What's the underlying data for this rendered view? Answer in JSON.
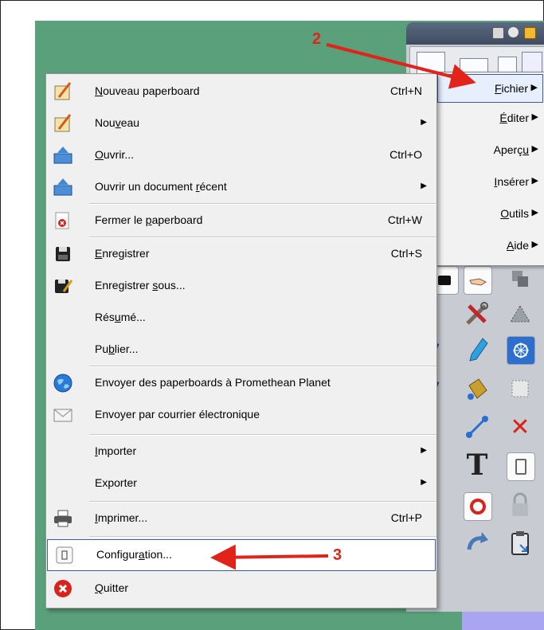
{
  "menu": {
    "items": [
      {
        "pre": "",
        "acc": "N",
        "post": "ouveau paperboard",
        "shortcut": "Ctrl+N",
        "submenu": false
      },
      {
        "pre": "Nou",
        "acc": "v",
        "post": "eau",
        "shortcut": "",
        "submenu": true
      },
      {
        "pre": "",
        "acc": "O",
        "post": "uvrir...",
        "shortcut": "Ctrl+O",
        "submenu": false
      },
      {
        "pre": "Ouvrir un document ",
        "acc": "r",
        "post": "écent",
        "shortcut": "",
        "submenu": true
      },
      {
        "pre": "Fermer le ",
        "acc": "p",
        "post": "aperboard",
        "shortcut": "Ctrl+W",
        "submenu": false
      },
      {
        "pre": "",
        "acc": "E",
        "post": "nregistrer",
        "shortcut": "Ctrl+S",
        "submenu": false
      },
      {
        "pre": "Enregistrer ",
        "acc": "s",
        "post": "ous...",
        "shortcut": "",
        "submenu": false
      },
      {
        "pre": "Rés",
        "acc": "u",
        "post": "mé...",
        "shortcut": "",
        "submenu": false
      },
      {
        "pre": "Pu",
        "acc": "b",
        "post": "lier...",
        "shortcut": "",
        "submenu": false
      },
      {
        "pre": "Envoyer des paperboards à Promethean Planet",
        "acc": "",
        "post": "",
        "shortcut": "",
        "submenu": false
      },
      {
        "pre": "Envoyer par courrier électronique",
        "acc": "",
        "post": "",
        "shortcut": "",
        "submenu": false
      },
      {
        "pre": "",
        "acc": "I",
        "post": "mporter",
        "shortcut": "",
        "submenu": true
      },
      {
        "pre": "Exporter",
        "acc": "",
        "post": "",
        "shortcut": "",
        "submenu": true
      },
      {
        "pre": "",
        "acc": "I",
        "post": "mprimer...",
        "shortcut": "Ctrl+P",
        "submenu": false
      },
      {
        "pre": "Configur",
        "acc": "a",
        "post": "tion...",
        "shortcut": "",
        "submenu": false
      },
      {
        "pre": "",
        "acc": "Q",
        "post": "uitter",
        "shortcut": "",
        "submenu": false
      }
    ]
  },
  "submenu": {
    "items": [
      {
        "pre": "",
        "acc": "F",
        "post": "ichier"
      },
      {
        "pre": "",
        "acc": "É",
        "post": "diter"
      },
      {
        "pre": "Aperç",
        "acc": "u",
        "post": ""
      },
      {
        "pre": "",
        "acc": "I",
        "post": "nsérer"
      },
      {
        "pre": "",
        "acc": "O",
        "post": "utils"
      },
      {
        "pre": "",
        "acc": "A",
        "post": "ide"
      }
    ]
  },
  "callouts": {
    "step2": "2",
    "step3": "3"
  },
  "colors": {
    "accent": "#3c5ba8",
    "callout": "#e2231a",
    "desktop": "#5aa07a",
    "desktop_purple": "#a9a5f0"
  }
}
